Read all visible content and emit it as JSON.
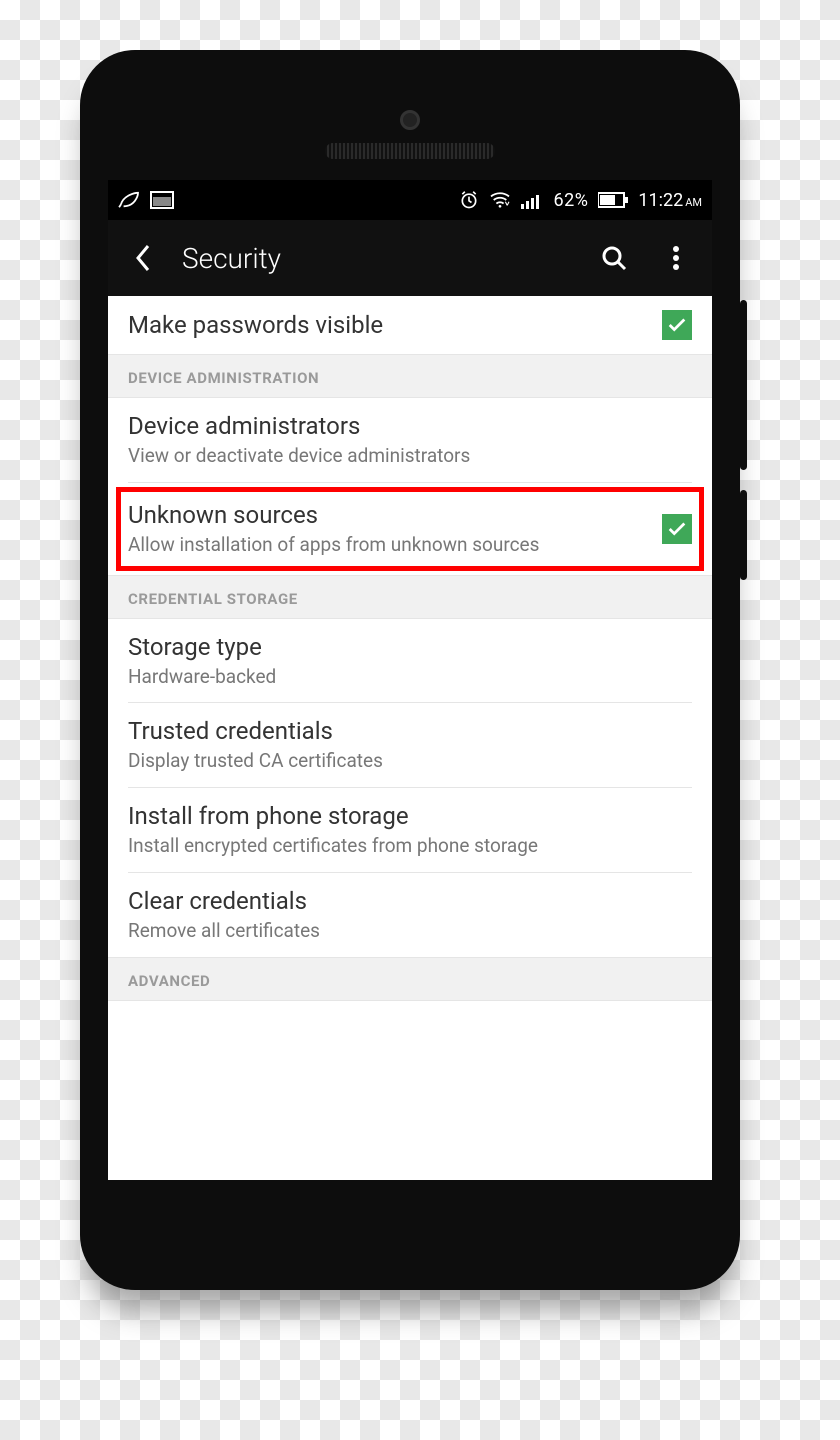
{
  "statusbar": {
    "battery_pct": "62%",
    "time": "11:22",
    "ampm": "AM"
  },
  "appbar": {
    "title": "Security"
  },
  "rows": {
    "passwords": {
      "label": "Make passwords visible"
    },
    "section_device": "DEVICE ADMINISTRATION",
    "device_admin": {
      "label": "Device administrators",
      "sub": "View or deactivate device administrators"
    },
    "unknown": {
      "label": "Unknown sources",
      "sub": "Allow installation of apps from unknown sources"
    },
    "section_cred": "CREDENTIAL STORAGE",
    "storage": {
      "label": "Storage type",
      "sub": "Hardware-backed"
    },
    "trusted": {
      "label": "Trusted credentials",
      "sub": "Display trusted CA certificates"
    },
    "install": {
      "label": "Install from phone storage",
      "sub": "Install encrypted certificates from phone storage"
    },
    "clear": {
      "label": "Clear credentials",
      "sub": "Remove all certificates"
    },
    "section_adv": "ADVANCED"
  },
  "colors": {
    "accent": "#3fa858",
    "highlight": "#ff0000"
  }
}
